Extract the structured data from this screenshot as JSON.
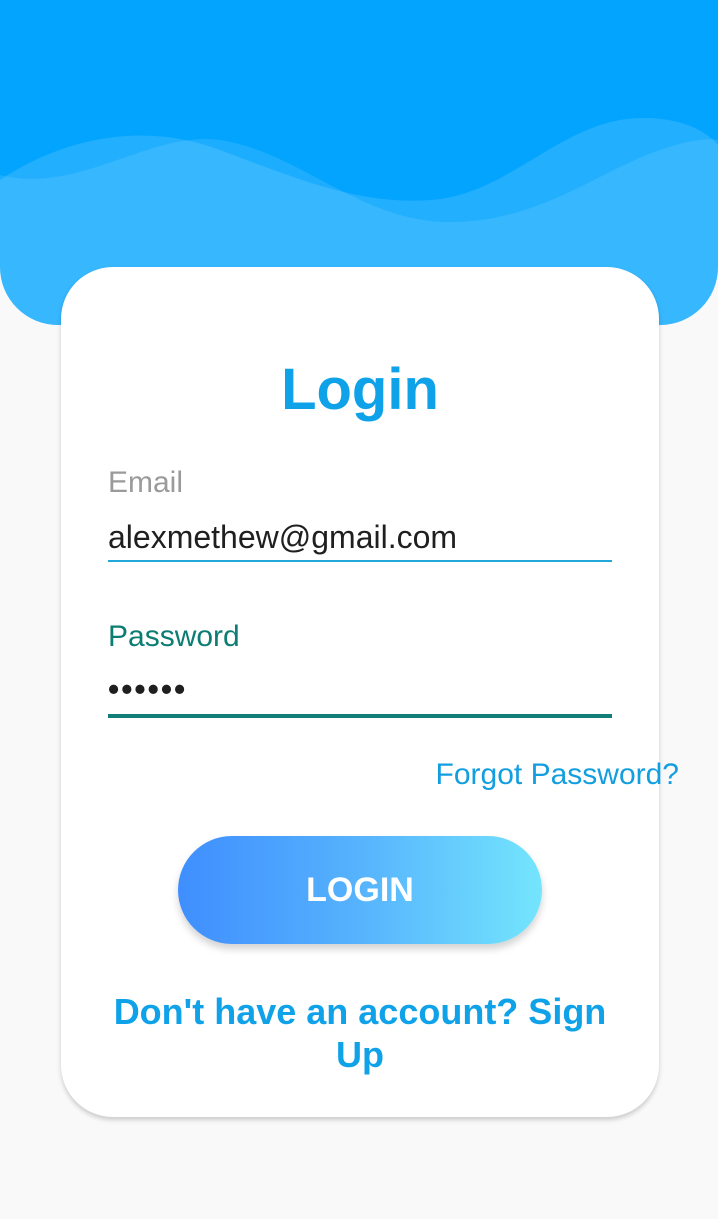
{
  "colors": {
    "header_blue": "#03a4fe",
    "wave_light": "#3cb8fe",
    "accent_blue": "#0fa2e9",
    "focus_teal": "#117f78",
    "page_bg": "#f9f9f9",
    "card_bg": "#ffffff",
    "button_gradient_start": "#3f8efe",
    "button_gradient_end": "#74e5fd"
  },
  "login": {
    "title": "Login",
    "email": {
      "label": "Email",
      "value": "alexmethew@gmail.com"
    },
    "password": {
      "label": "Password",
      "value": "••••••"
    },
    "forgot_password": "Forgot Password?",
    "login_button": "LOGIN",
    "signup_prompt": "Don't have an account? Sign Up"
  }
}
